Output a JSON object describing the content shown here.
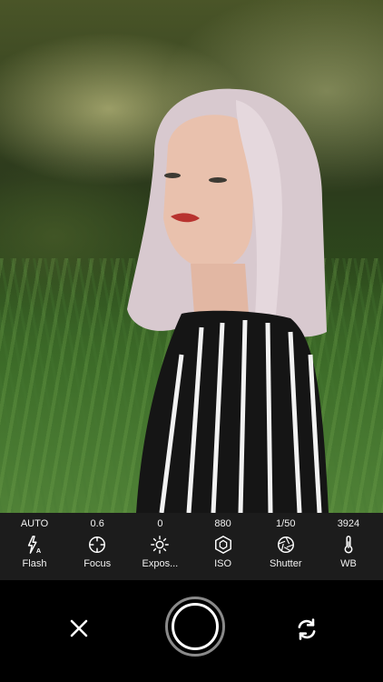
{
  "viewfinder": {
    "alt": "Camera preview"
  },
  "settings": [
    {
      "value": "AUTO",
      "label": "Flash",
      "icon": "flash-auto-icon"
    },
    {
      "value": "0.6",
      "label": "Focus",
      "icon": "focus-icon"
    },
    {
      "value": "0",
      "label": "Expos...",
      "icon": "exposure-icon"
    },
    {
      "value": "880",
      "label": "ISO",
      "icon": "iso-icon"
    },
    {
      "value": "1/50",
      "label": "Shutter",
      "icon": "shutter-speed-icon"
    },
    {
      "value": "3924",
      "label": "WB",
      "icon": "thermometer-icon"
    }
  ],
  "controls": {
    "close_icon": "close-icon",
    "shutter_icon": "shutter-icon",
    "flip_icon": "flip-camera-icon"
  },
  "colors": {
    "bar": "#1c1c1c",
    "background": "#000000",
    "text": "#ffffff"
  }
}
